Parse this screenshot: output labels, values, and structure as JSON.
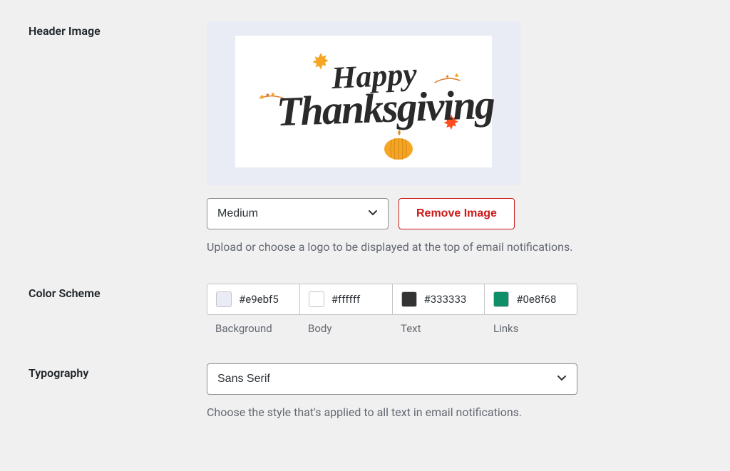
{
  "header_image": {
    "label": "Header Image",
    "preview_text_top": "Happy",
    "preview_text_bottom": "Thanksgiving",
    "size_select": "Medium",
    "remove_button": "Remove Image",
    "help": "Upload or choose a logo to be displayed at the top of email notifications."
  },
  "color_scheme": {
    "label": "Color Scheme",
    "items": [
      {
        "hex": "#e9ebf5",
        "label": "Background"
      },
      {
        "hex": "#ffffff",
        "label": "Body"
      },
      {
        "hex": "#333333",
        "label": "Text"
      },
      {
        "hex": "#0e8f68",
        "label": "Links"
      }
    ]
  },
  "typography": {
    "label": "Typography",
    "value": "Sans Serif",
    "help": "Choose the style that's applied to all text in email notifications."
  }
}
